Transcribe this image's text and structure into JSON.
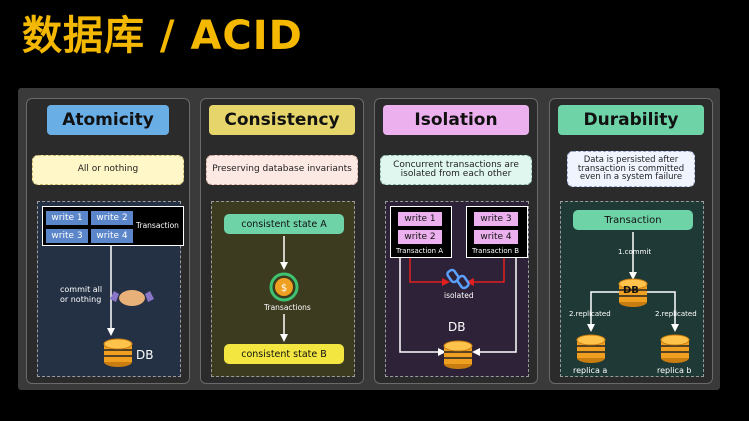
{
  "title": "数据库 / ACID",
  "atomicity": {
    "header": "Atomicity",
    "desc": "All or nothing",
    "writes": [
      "write 1",
      "write 2",
      "write 3",
      "write 4"
    ],
    "txn_label": "Transaction",
    "commit": "commit all\nor nothing",
    "db": "DB"
  },
  "consistency": {
    "header": "Consistency",
    "desc": "Preserving database invariants",
    "state_a": "consistent state A",
    "txn_label": "Transactions",
    "state_b": "consistent state B"
  },
  "isolation": {
    "header": "Isolation",
    "desc": "Concurrent transactions are\nisolated from each other",
    "txn_a_writes": [
      "write 1",
      "write 2"
    ],
    "txn_a_label": "Transaction A",
    "txn_b_writes": [
      "write 3",
      "write 4"
    ],
    "txn_b_label": "Transaction B",
    "isolated": "isolated",
    "db": "DB"
  },
  "durability": {
    "header": "Durability",
    "desc": "Data is persisted after\ntransaction is committed\neven in a system failure",
    "txn": "Transaction",
    "commit": "1.commit",
    "db": "DB",
    "replicated_left": "2.replicated",
    "replicated_right": "2.replicated",
    "replica_a": "replica a",
    "replica_b": "replica b"
  },
  "colors": {
    "title": "#f5b800",
    "atomicity": "#6aaee6",
    "consistency": "#e6d56a",
    "isolation": "#ecb0ee",
    "durability": "#6fd3a8",
    "db": "#f0a020"
  }
}
